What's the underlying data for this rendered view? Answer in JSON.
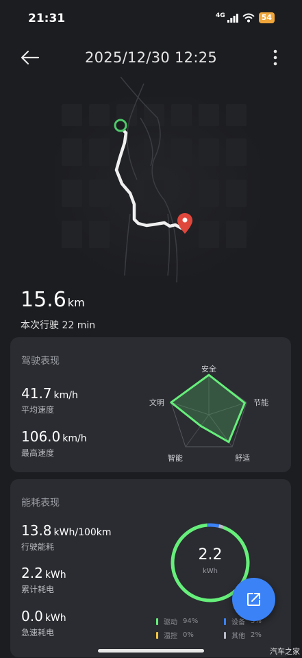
{
  "status_bar": {
    "time": "21:31",
    "network": "4G",
    "battery": "54",
    "battery_color": "#f0a63a"
  },
  "header": {
    "title": "2025/12/30 12:25",
    "back_icon": "arrow-left-icon",
    "more_icon": "more-vertical-icon"
  },
  "trip": {
    "distance": "15.6",
    "distance_unit": "km",
    "duration_text": "本次行驶 22 min"
  },
  "driving": {
    "title": "驾驶表现",
    "avg_speed": {
      "value": "41.7",
      "unit": "km/h",
      "label": "平均速度"
    },
    "max_speed": {
      "value": "106.0",
      "unit": "km/h",
      "label": "最高速度"
    },
    "radar": {
      "axes": [
        "安全",
        "节能",
        "舒适",
        "智能",
        "文明"
      ],
      "scores": [
        1.0,
        0.95,
        0.85,
        0.35,
        1.0
      ],
      "accent": "#66ef7a"
    }
  },
  "energy": {
    "title": "能耗表现",
    "consumption": {
      "value": "13.8",
      "unit": "kWh/100km",
      "label": "行驶能耗"
    },
    "total": {
      "value": "2.2",
      "unit": "kWh",
      "label": "累计耗电"
    },
    "sudden": {
      "value": "0.0",
      "unit": "kWh",
      "label": "急速耗电"
    },
    "ring": {
      "value": "2.2",
      "unit": "kWh"
    },
    "legend": [
      {
        "name": "驱动",
        "pct": "94%",
        "color": "#66ef7a",
        "fraction": 0.94
      },
      {
        "name": "设备",
        "pct": "5%",
        "color": "#3b82f6",
        "fraction": 0.05
      },
      {
        "name": "温控",
        "pct": "0%",
        "color": "#f5c542",
        "fraction": 0.0
      },
      {
        "name": "其他",
        "pct": "2%",
        "color": "#b9bcc8",
        "fraction": 0.02
      }
    ]
  },
  "fab": {
    "icon": "share-export-icon",
    "color": "#3b82f6"
  },
  "watermark": "汽车之家"
}
